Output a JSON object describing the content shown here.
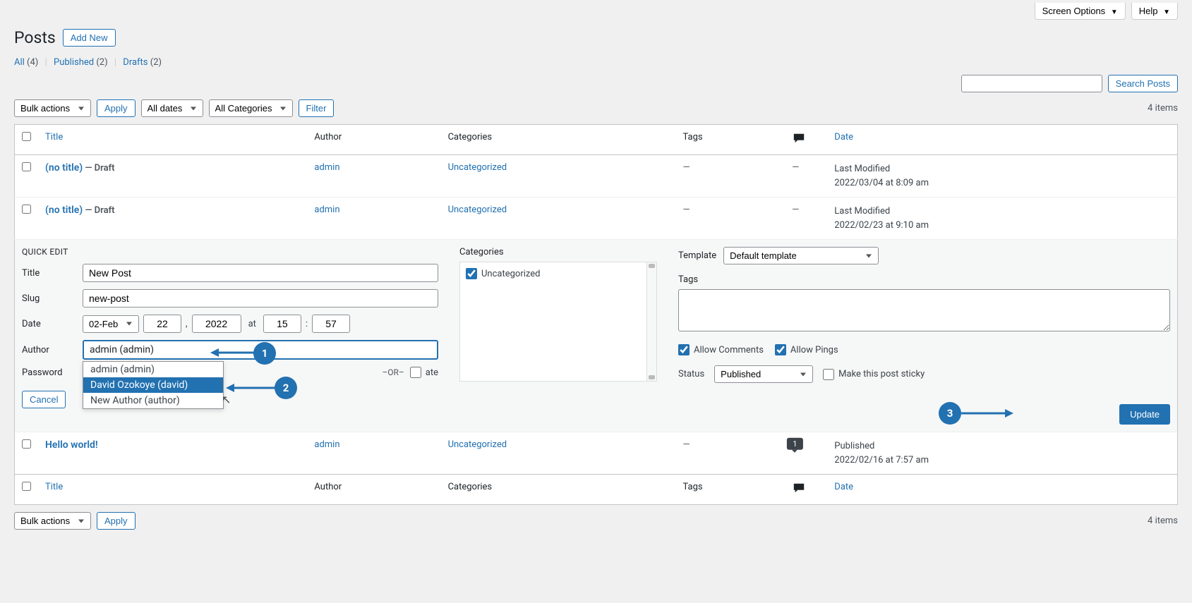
{
  "top": {
    "screen_options": "Screen Options",
    "help": "Help"
  },
  "heading": "Posts",
  "add_new": "Add New",
  "filters": {
    "all": "All",
    "all_count": "(4)",
    "published": "Published",
    "published_count": "(2)",
    "drafts": "Drafts",
    "drafts_count": "(2)"
  },
  "search_btn": "Search Posts",
  "bulk_actions": "Bulk actions",
  "apply": "Apply",
  "all_dates": "All dates",
  "all_categories": "All Categories",
  "filter_btn": "Filter",
  "items_count": "4 items",
  "columns": {
    "title": "Title",
    "author": "Author",
    "categories": "Categories",
    "tags": "Tags",
    "date": "Date"
  },
  "rows": [
    {
      "title": "(no title)",
      "status": "— Draft",
      "author": "admin",
      "category": "Uncategorized",
      "tags": "—",
      "comments": "—",
      "date_label": "Last Modified",
      "date_val": "2022/03/04 at 8:09 am"
    },
    {
      "title": "(no title)",
      "status": "— Draft",
      "author": "admin",
      "category": "Uncategorized",
      "tags": "—",
      "comments": "—",
      "date_label": "Last Modified",
      "date_val": "2022/02/23 at 9:10 am"
    }
  ],
  "row_hello": {
    "title": "Hello world!",
    "author": "admin",
    "category": "Uncategorized",
    "tags": "—",
    "comments": "1",
    "date_label": "Published",
    "date_val": "2022/02/16 at 7:57 am"
  },
  "quickedit": {
    "heading": "QUICK EDIT",
    "title_label": "Title",
    "title_val": "New Post",
    "slug_label": "Slug",
    "slug_val": "new-post",
    "date_label": "Date",
    "month": "02-Feb",
    "day": "22",
    "year": "2022",
    "at": "at",
    "hour": "15",
    "min": "57",
    "author_label": "Author",
    "author_val": "admin (admin)",
    "author_opts": [
      "admin (admin)",
      "David Ozokoye (david)",
      "New Author (author)"
    ],
    "password_label": "Password",
    "or": "–OR–",
    "private": "ate",
    "categories_label": "Categories",
    "cat_uncat": "Uncategorized",
    "template_label": "Template",
    "template_val": "Default template",
    "tags_label": "Tags",
    "allow_comments": "Allow Comments",
    "allow_pings": "Allow Pings",
    "status_label": "Status",
    "status_val": "Published",
    "sticky": "Make this post sticky",
    "cancel": "Cancel",
    "update": "Update"
  },
  "annotations": {
    "a1": "1",
    "a2": "2",
    "a3": "3"
  }
}
